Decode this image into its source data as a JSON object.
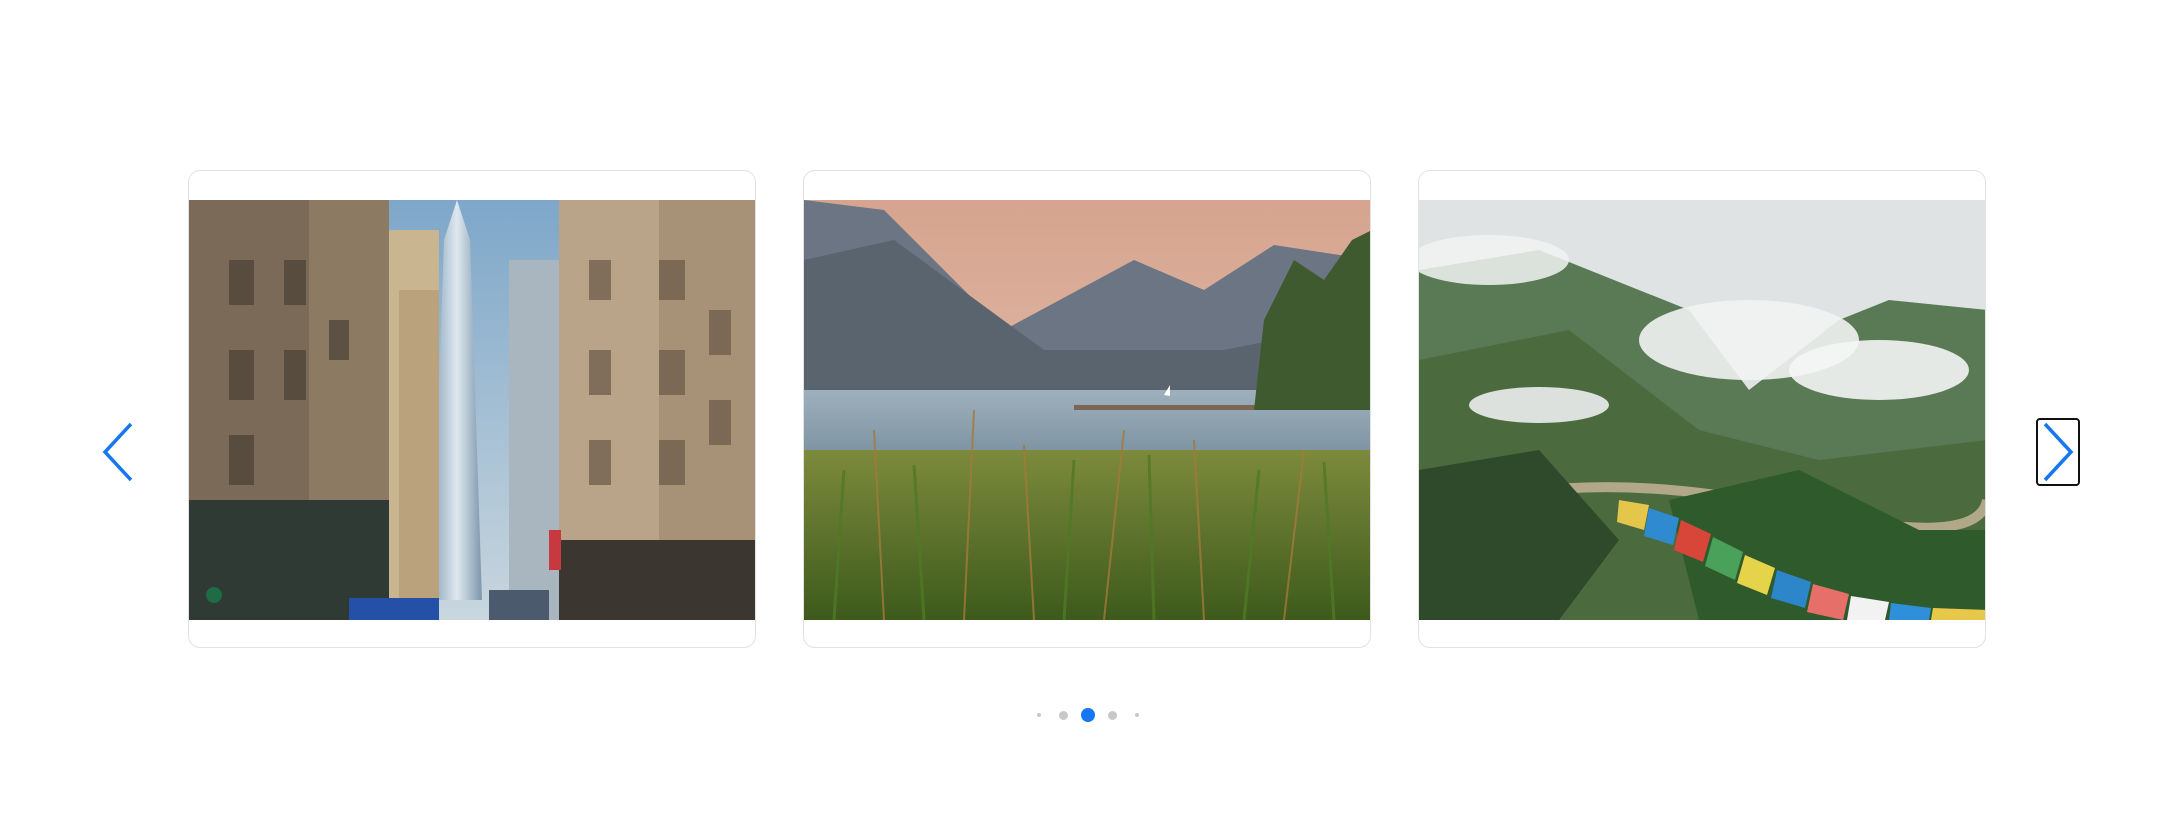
{
  "carousel": {
    "slides": [
      {
        "name": "city-street-skyscraper",
        "alt": ""
      },
      {
        "name": "lake-reeds-mountains",
        "alt": ""
      },
      {
        "name": "misty-mountains-prayer-flags",
        "alt": ""
      }
    ],
    "prev_icon": "chevron-left-icon",
    "next_icon": "chevron-right-icon",
    "dots": {
      "count": 5,
      "active_index": 2
    },
    "colors": {
      "accent": "#1677f0",
      "dot_inactive": "#c8c8c8",
      "card_border": "#e2e2e2"
    }
  }
}
